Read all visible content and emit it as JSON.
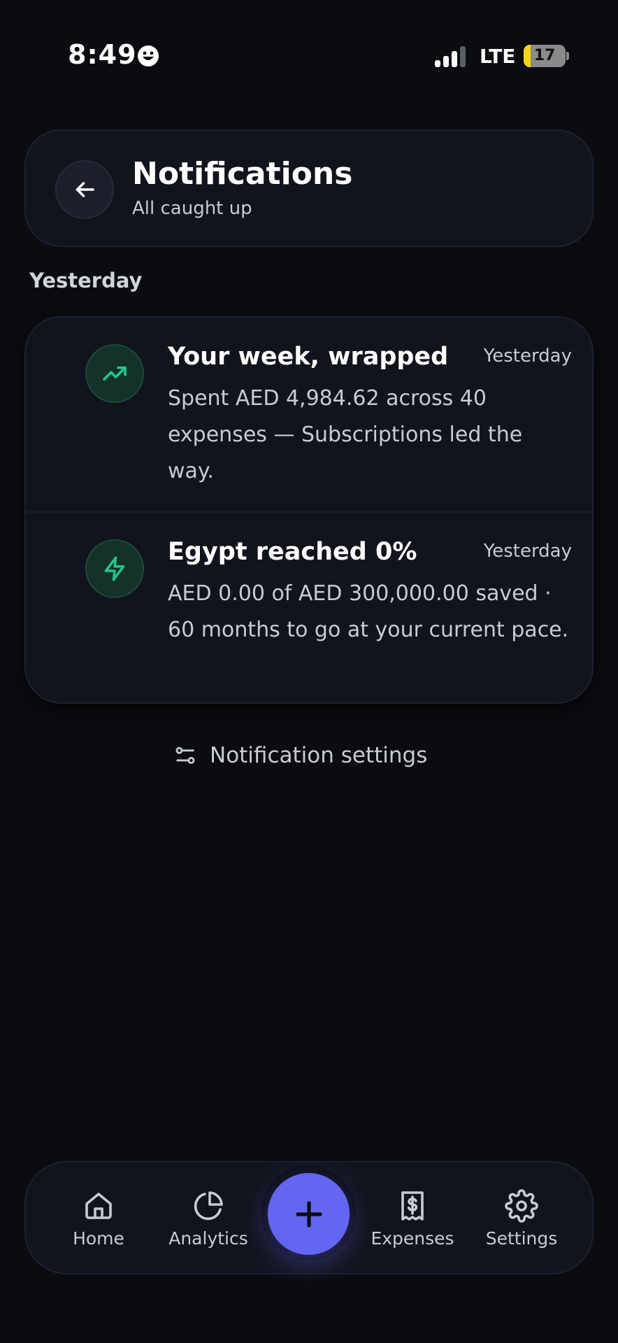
{
  "status_bar": {
    "time": "8:49",
    "network": "LTE",
    "battery_level": "17",
    "battery_fraction": 0.17,
    "icons": [
      "smiley-icon",
      "signal-icon",
      "battery-icon"
    ]
  },
  "header": {
    "title": "Notifications",
    "subtitle": "All caught up",
    "back_icon": "arrow-left-icon"
  },
  "section_label": "Yesterday",
  "notifications": [
    {
      "icon": "trending-up-icon",
      "title": "Your week, wrapped",
      "time": "Yesterday",
      "body": "Spent AED 4,984.62 across 40 expenses — Subscriptions led the way."
    },
    {
      "icon": "lightning-icon",
      "title": "Egypt reached 0%",
      "time": "Yesterday",
      "body": "AED 0.00 of AED 300,000.00 saved · 60 months to go at your current pace."
    }
  ],
  "settings_link": {
    "label": "Notification settings",
    "icon": "sliders-icon"
  },
  "bottom_nav": {
    "items": [
      {
        "label": "Home",
        "icon": "home-icon"
      },
      {
        "label": "Analytics",
        "icon": "pie-chart-icon"
      },
      {
        "label": "Expenses",
        "icon": "receipt-icon"
      },
      {
        "label": "Settings",
        "icon": "gear-icon"
      }
    ],
    "fab_icon": "plus-icon"
  },
  "colors": {
    "background": "#0b0c10",
    "card": "#12141d",
    "accent": "#6366f1",
    "success_green": "#22c58b",
    "text_muted": "#c9cbd4"
  }
}
